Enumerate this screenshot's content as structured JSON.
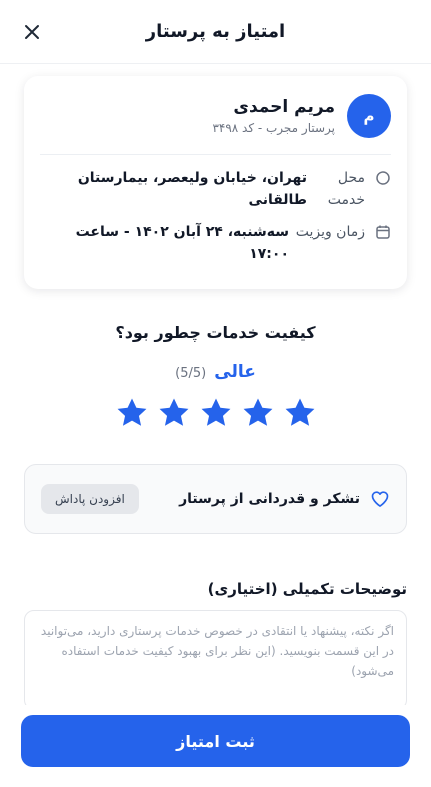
{
  "header": {
    "title": "امتیاز به پرستار"
  },
  "nurse": {
    "avatar_initial": "م",
    "name": "مریم احمدی",
    "subtitle": "پرستار مجرب - کد ۳۴۹۸"
  },
  "visit": {
    "location_label": "محل خدمت",
    "location_value": "تهران، خیابان ولیعصر، بیمارستان طالقانی",
    "time_label": "زمان ویزیت",
    "time_value": "سه‌شنبه، ۲۴ آبان ۱۴۰۲ - ساعت ۱۷:۰۰"
  },
  "rating": {
    "question": "کیفیت خدمات چطور بود؟",
    "word": "عالی",
    "score_text": "(5/5)",
    "value": 5,
    "max": 5
  },
  "thanks": {
    "label": "تشکر و قدردانی از پرستار",
    "button": "افزودن پاداش"
  },
  "notes": {
    "title": "توضیحات تکمیلی (اختیاری)",
    "placeholder": "اگر نکته، پیشنهاد یا انتقادی در خصوص خدمات پرستاری دارید، می‌توانید در این قسمت بنویسید. (این نظر برای بهبود کیفیت خدمات استفاده می‌شود)"
  },
  "submit": {
    "label": "ثبت امتیاز"
  },
  "colors": {
    "accent": "#2563eb",
    "star": "#2563eb"
  }
}
